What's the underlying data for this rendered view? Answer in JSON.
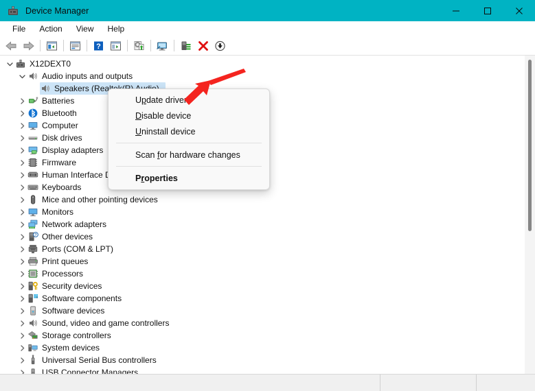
{
  "window": {
    "title": "Device Manager",
    "app_icon": "device-manager-icon",
    "titlebar_color": "#00b3c3",
    "controls": {
      "minimize": "minimize-button",
      "maximize": "maximize-button",
      "close": "close-button"
    }
  },
  "menubar": {
    "items": [
      {
        "label": "File"
      },
      {
        "label": "Action"
      },
      {
        "label": "View"
      },
      {
        "label": "Help"
      }
    ]
  },
  "toolbar": {
    "buttons": [
      {
        "name": "back-button",
        "icon": "back-arrow-icon"
      },
      {
        "name": "forward-button",
        "icon": "forward-arrow-icon"
      },
      {
        "name": "separator-1",
        "icon": "separator"
      },
      {
        "name": "show-hide-console-tree-button",
        "icon": "console-tree-icon"
      },
      {
        "name": "separator-2",
        "icon": "separator"
      },
      {
        "name": "properties-button",
        "icon": "properties-window-icon"
      },
      {
        "name": "separator-3",
        "icon": "separator"
      },
      {
        "name": "help-button",
        "icon": "help-question-icon"
      },
      {
        "name": "show-hide-action-pane-button",
        "icon": "action-pane-icon"
      },
      {
        "name": "separator-4",
        "icon": "separator"
      },
      {
        "name": "update-driver-button",
        "icon": "update-driver-icon"
      },
      {
        "name": "separator-5",
        "icon": "separator"
      },
      {
        "name": "scan-for-hardware-changes-button",
        "icon": "scan-hardware-icon"
      },
      {
        "name": "separator-6",
        "icon": "separator"
      },
      {
        "name": "enable-device-button",
        "icon": "enable-device-icon"
      },
      {
        "name": "uninstall-device-button",
        "icon": "red-x-icon"
      },
      {
        "name": "disable-device-button",
        "icon": "down-arrow-circle-icon"
      }
    ]
  },
  "tree": {
    "nodes": [
      {
        "label": "X12DEXT0",
        "level": 0,
        "expander": "expanded",
        "icon": "computer-node-icon",
        "selected": false
      },
      {
        "label": "Audio inputs and outputs",
        "level": 1,
        "expander": "expanded",
        "icon": "speaker-icon",
        "selected": false
      },
      {
        "label": "Speakers (Realtek(R) Audio)",
        "level": 2,
        "expander": "none",
        "icon": "speaker-icon",
        "selected": true
      },
      {
        "label": "Batteries",
        "level": 1,
        "expander": "collapsed",
        "icon": "battery-icon",
        "selected": false
      },
      {
        "label": "Bluetooth",
        "level": 1,
        "expander": "collapsed",
        "icon": "bluetooth-icon",
        "selected": false
      },
      {
        "label": "Computer",
        "level": 1,
        "expander": "collapsed",
        "icon": "monitor-icon",
        "selected": false
      },
      {
        "label": "Disk drives",
        "level": 1,
        "expander": "collapsed",
        "icon": "disk-drive-icon",
        "selected": false
      },
      {
        "label": "Display adapters",
        "level": 1,
        "expander": "collapsed",
        "icon": "display-adapter-icon",
        "selected": false
      },
      {
        "label": "Firmware",
        "level": 1,
        "expander": "collapsed",
        "icon": "firmware-chip-icon",
        "selected": false
      },
      {
        "label": "Human Interface Devices",
        "level": 1,
        "expander": "collapsed",
        "icon": "hid-icon",
        "selected": false
      },
      {
        "label": "Keyboards",
        "level": 1,
        "expander": "collapsed",
        "icon": "keyboard-icon",
        "selected": false
      },
      {
        "label": "Mice and other pointing devices",
        "level": 1,
        "expander": "collapsed",
        "icon": "mouse-icon",
        "selected": false
      },
      {
        "label": "Monitors",
        "level": 1,
        "expander": "collapsed",
        "icon": "monitor-icon",
        "selected": false
      },
      {
        "label": "Network adapters",
        "level": 1,
        "expander": "collapsed",
        "icon": "network-adapter-icon",
        "selected": false
      },
      {
        "label": "Other devices",
        "level": 1,
        "expander": "collapsed",
        "icon": "other-device-icon",
        "selected": false
      },
      {
        "label": "Ports (COM & LPT)",
        "level": 1,
        "expander": "collapsed",
        "icon": "port-icon",
        "selected": false
      },
      {
        "label": "Print queues",
        "level": 1,
        "expander": "collapsed",
        "icon": "printer-icon",
        "selected": false
      },
      {
        "label": "Processors",
        "level": 1,
        "expander": "collapsed",
        "icon": "processor-icon",
        "selected": false
      },
      {
        "label": "Security devices",
        "level": 1,
        "expander": "collapsed",
        "icon": "security-device-icon",
        "selected": false
      },
      {
        "label": "Software components",
        "level": 1,
        "expander": "collapsed",
        "icon": "software-component-icon",
        "selected": false
      },
      {
        "label": "Software devices",
        "level": 1,
        "expander": "collapsed",
        "icon": "software-device-icon",
        "selected": false
      },
      {
        "label": "Sound, video and game controllers",
        "level": 1,
        "expander": "collapsed",
        "icon": "speaker-icon",
        "selected": false
      },
      {
        "label": "Storage controllers",
        "level": 1,
        "expander": "collapsed",
        "icon": "storage-controller-icon",
        "selected": false
      },
      {
        "label": "System devices",
        "level": 1,
        "expander": "collapsed",
        "icon": "system-device-icon",
        "selected": false
      },
      {
        "label": "Universal Serial Bus controllers",
        "level": 1,
        "expander": "collapsed",
        "icon": "usb-icon",
        "selected": false
      },
      {
        "label": "USB Connector Managers",
        "level": 1,
        "expander": "collapsed",
        "icon": "usb-connector-icon",
        "selected": false
      }
    ]
  },
  "context_menu": {
    "items": [
      {
        "label": "Update driver",
        "accel_index": 1,
        "bold": false,
        "separator_after": false
      },
      {
        "label": "Disable device",
        "accel_index": 0,
        "bold": false,
        "separator_after": false
      },
      {
        "label": "Uninstall device",
        "accel_index": 0,
        "bold": false,
        "separator_after": true
      },
      {
        "label": "Scan for hardware changes",
        "accel_index": 5,
        "bold": false,
        "separator_after": true
      },
      {
        "label": "Properties",
        "accel_index": 1,
        "bold": true,
        "separator_after": false
      }
    ]
  },
  "annotation": {
    "arrow_color": "#f4241f",
    "arrow_name": "red-pointer-arrow",
    "points_to": "Update driver"
  },
  "statusbar": {
    "pane1": "",
    "pane2": "",
    "pane3": ""
  },
  "scrollbar": {
    "name": "vertical-scrollbar",
    "thumb": "scrollbar-thumb"
  }
}
